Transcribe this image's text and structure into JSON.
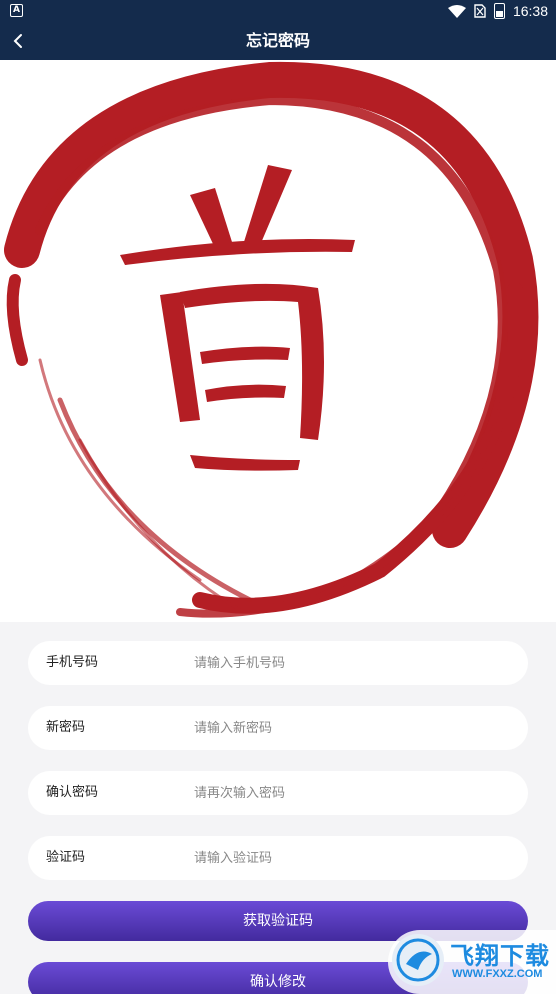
{
  "status_bar": {
    "notification": "A",
    "time": "16:38"
  },
  "header": {
    "title": "忘记密码"
  },
  "hero": {
    "logo_char": "首"
  },
  "form": {
    "fields": [
      {
        "label": "手机号码",
        "placeholder": "请输入手机号码",
        "value": ""
      },
      {
        "label": "新密码",
        "placeholder": "请输入新密码",
        "value": ""
      },
      {
        "label": "确认密码",
        "placeholder": "请再次输入密码",
        "value": ""
      },
      {
        "label": "验证码",
        "placeholder": "请输入验证码",
        "value": ""
      }
    ],
    "get_code_label": "获取验证码",
    "confirm_label": "确认修改"
  },
  "watermark": {
    "title": "飞翔下载",
    "url": "WWW.FXXZ.COM"
  },
  "colors": {
    "nav": "#142b4c",
    "seal_red": "#b41e24",
    "button_top": "#6a4bd6",
    "button_bottom": "#432a9e",
    "page_bg": "#f4f4f6"
  }
}
